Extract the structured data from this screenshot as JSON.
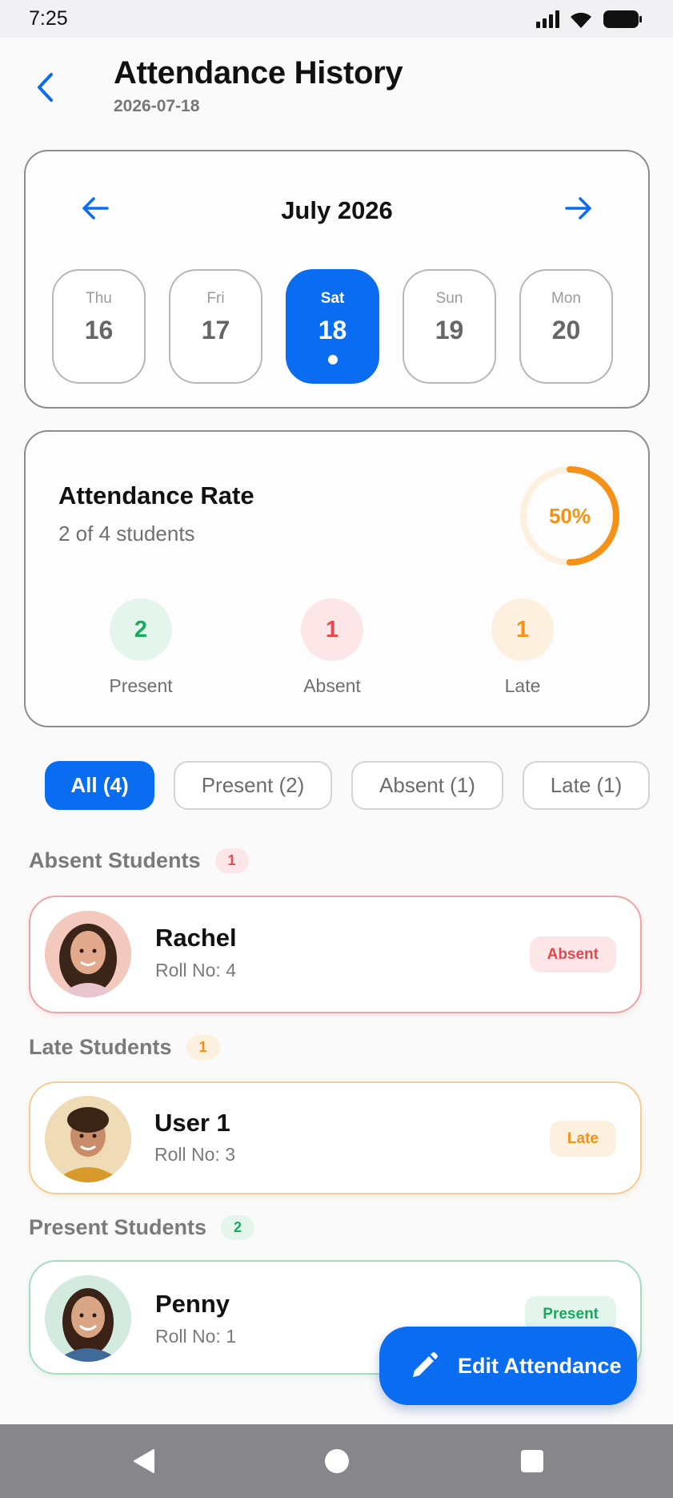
{
  "status_bar": {
    "time": "7:25"
  },
  "header": {
    "title": "Attendance History",
    "date": "2026-07-18"
  },
  "calendar": {
    "month": "July 2026",
    "days": [
      {
        "name": "Thu",
        "num": "16",
        "selected": false
      },
      {
        "name": "Fri",
        "num": "17",
        "selected": false
      },
      {
        "name": "Sat",
        "num": "18",
        "selected": true
      },
      {
        "name": "Sun",
        "num": "19",
        "selected": false
      },
      {
        "name": "Mon",
        "num": "20",
        "selected": false
      }
    ]
  },
  "rate": {
    "title": "Attendance Rate",
    "subtitle": "2 of 4 students",
    "percent_label": "50%",
    "percent_value": 0.5,
    "stats": [
      {
        "value": "2",
        "label": "Present",
        "color": "#1aa85f",
        "bg": "#e4f5ec"
      },
      {
        "value": "1",
        "label": "Absent",
        "color": "#e5484d",
        "bg": "#fde6e7"
      },
      {
        "value": "1",
        "label": "Late",
        "color": "#f39217",
        "bg": "#fdf0df"
      }
    ]
  },
  "filters": [
    {
      "label": "All (4)",
      "active": true
    },
    {
      "label": "Present (2)",
      "active": false
    },
    {
      "label": "Absent (1)",
      "active": false
    },
    {
      "label": "Late (1)",
      "active": false
    }
  ],
  "sections": {
    "absent": {
      "title": "Absent Students",
      "count": "1"
    },
    "late": {
      "title": "Late Students",
      "count": "1"
    },
    "present": {
      "title": "Present Students",
      "count": "2"
    }
  },
  "students": {
    "rachel": {
      "name": "Rachel",
      "roll": "Roll No: 4",
      "status": "Absent"
    },
    "user1": {
      "name": "User 1",
      "roll": "Roll No: 3",
      "status": "Late"
    },
    "penny": {
      "name": "Penny",
      "roll": "Roll No: 1",
      "status": "Present"
    }
  },
  "fab": {
    "label": "Edit Attendance",
    "icon": "pencil-icon"
  },
  "colors": {
    "accent": "#0a6cf0",
    "present": "#1aa85f",
    "absent": "#e5484d",
    "late": "#f39217"
  }
}
